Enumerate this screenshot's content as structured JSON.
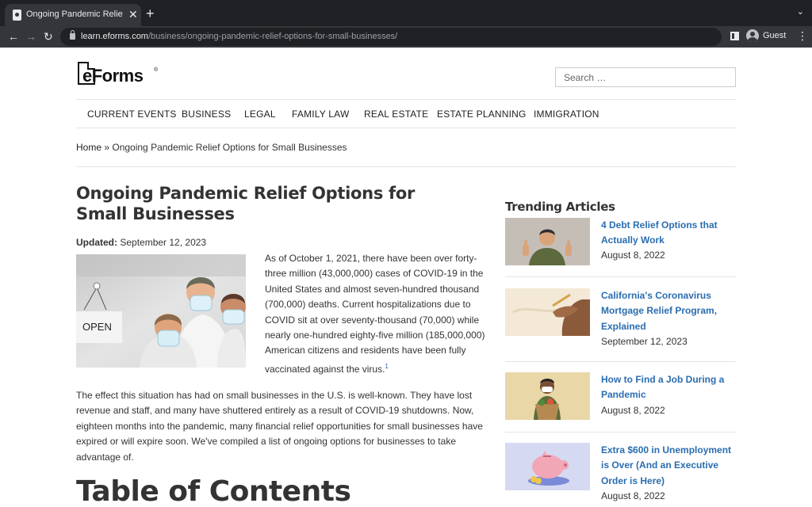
{
  "browser": {
    "tab_title": "Ongoing Pandemic Relief Options for Small Businesses",
    "tab_close": "✕",
    "new_tab": "+",
    "tab_menu": "⌄",
    "url_host": "learn.eforms.com",
    "url_path": "/business/ongoing-pandemic-relief-options-for-small-businesses/",
    "profile_label": "Guest",
    "back": "←",
    "forward": "→",
    "reload": "↻",
    "menu": "⋮"
  },
  "site": {
    "logo_text": "eForms",
    "logo_reg": "®",
    "search_placeholder": "Search …",
    "nav": [
      "CURRENT EVENTS",
      "BUSINESS",
      "LEGAL",
      "FAMILY LAW",
      "REAL ESTATE",
      "ESTATE PLANNING",
      "IMMIGRATION"
    ]
  },
  "breadcrumb": {
    "home": "Home",
    "separator": " » ",
    "current": "Ongoing Pandemic Relief Options for Small Businesses"
  },
  "article": {
    "title": "Ongoing Pandemic Relief Options for Small Businesses",
    "updated_label": "Updated:",
    "updated_date": "September 12, 2023",
    "hero_sign": "OPEN",
    "intro": "As of October 1, 2021, there have been over forty-three million (43,000,000) cases of COVID-19 in the United States and almost seven-hundred thousand (700,000) deaths. Current hospitalizations due to COVID sit at over seventy-thousand (70,000) while nearly one-hundred eighty-five million (185,000,000) American citizens and residents have been fully vaccinated against the virus.",
    "footnote": "1",
    "paragraph2": "The effect this situation has had on small businesses in the U.S. is well-known. They have lost revenue and staff, and many have shuttered entirely as a result of COVID-19 shutdowns. Now, eighteen months into the pandemic, many financial relief opportunities for small businesses have expired or will expire soon. We've compiled a list of ongoing options for businesses to take advantage of.",
    "toc_heading": "Table of Contents"
  },
  "sidebar": {
    "heading": "Trending Articles",
    "items": [
      {
        "title": "4 Debt Relief Options that Actually Work",
        "date": "August 8, 2022",
        "thumb": "thumbs-up-man"
      },
      {
        "title": "California's Coronavirus Mortgage Relief Program, Explained",
        "date": "September 12, 2023",
        "thumb": "hand-with-pen"
      },
      {
        "title": "How to Find a Job During a Pandemic",
        "date": "August 8, 2022",
        "thumb": "person-with-groceries"
      },
      {
        "title": "Extra $600 in Unemployment is Over (And an Executive Order is Here)",
        "date": "August 8, 2022",
        "thumb": "piggy-bank"
      }
    ]
  },
  "colors": {
    "link": "#2a6db0",
    "text": "#333333",
    "chrome_dark": "#202124",
    "chrome_mid": "#35363a"
  }
}
